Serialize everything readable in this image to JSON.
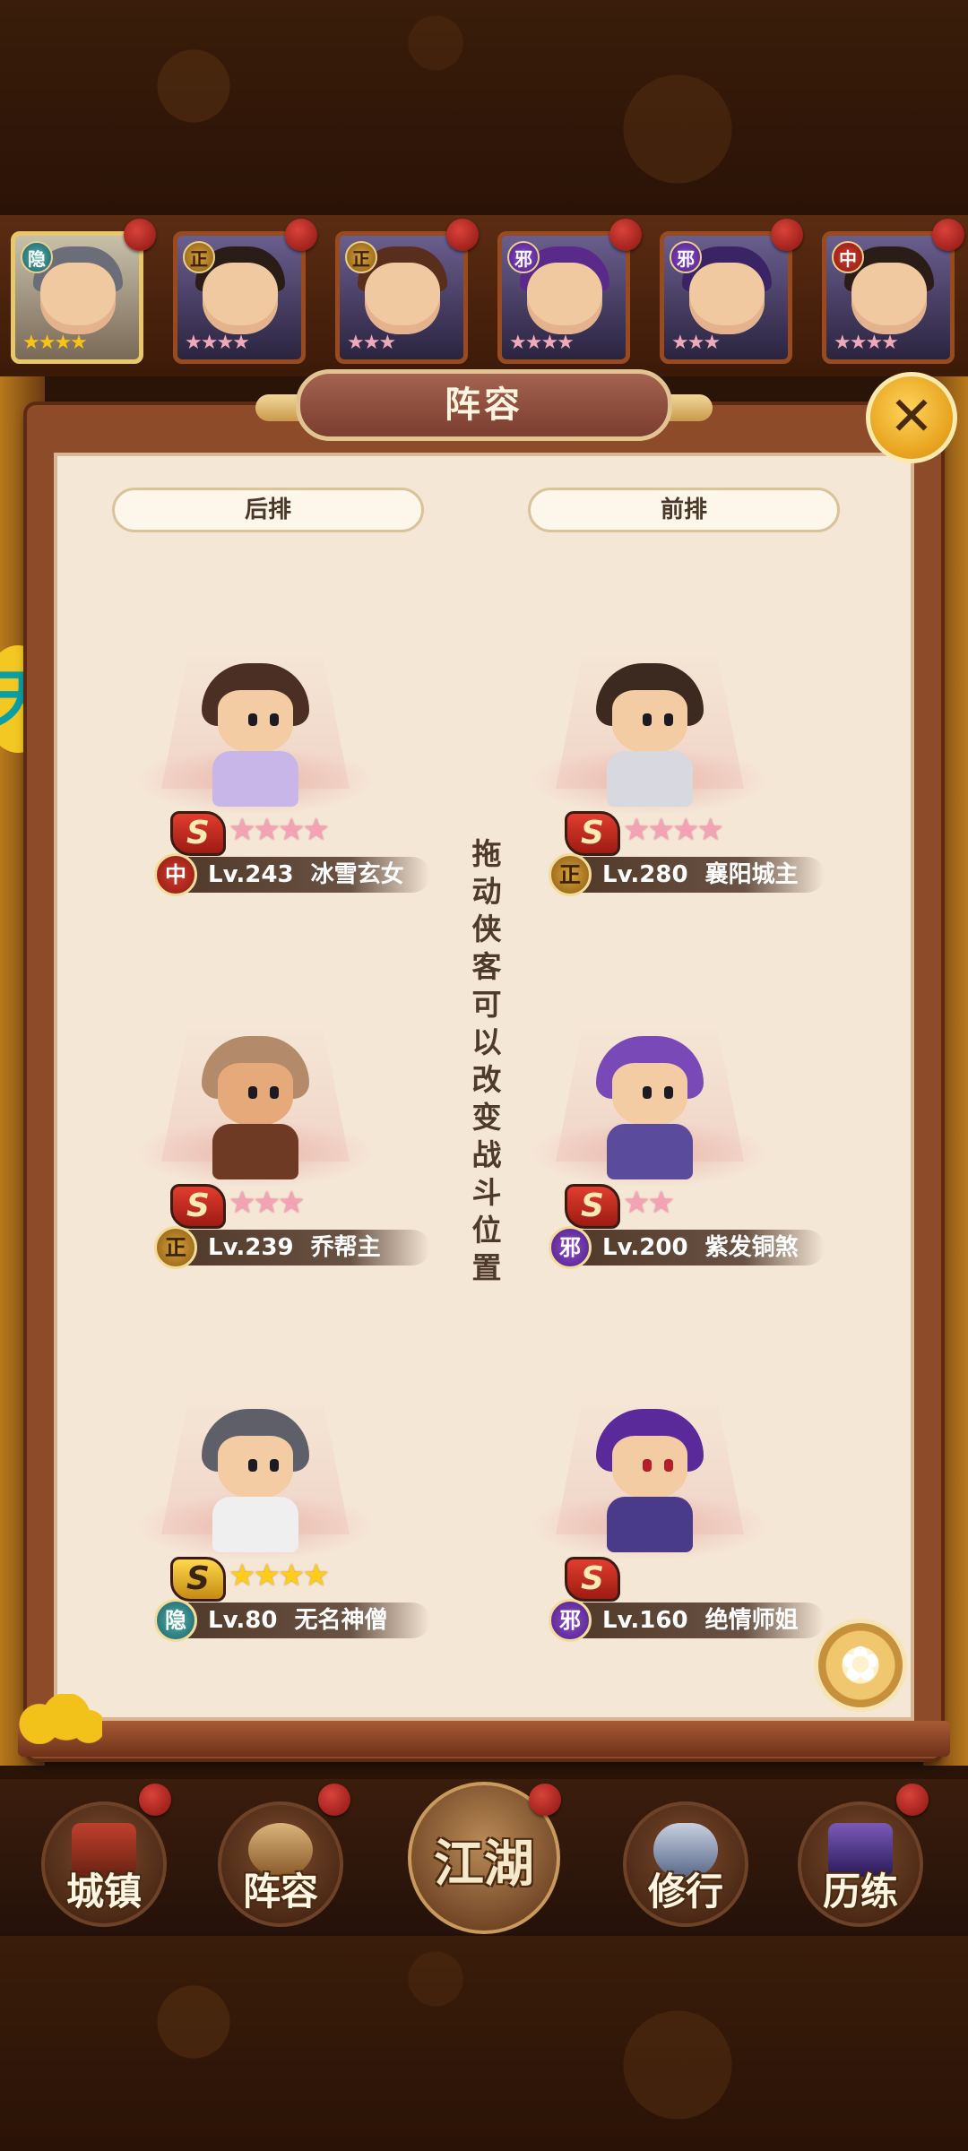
{
  "panel": {
    "title": "阵容",
    "back_row_label": "后排",
    "front_row_label": "前排",
    "hint": "拖动侠客可以改变战斗位置"
  },
  "top_strip": [
    {
      "alignment": "隐",
      "stars": "★★★★",
      "selected": true
    },
    {
      "alignment": "正",
      "stars": "★★★★",
      "selected": false
    },
    {
      "alignment": "正",
      "stars": "★★★",
      "selected": false
    },
    {
      "alignment": "邪",
      "stars": "★★★★",
      "selected": false
    },
    {
      "alignment": "邪",
      "stars": "★★★",
      "selected": false
    },
    {
      "alignment": "中",
      "stars": "★★★★",
      "selected": false
    }
  ],
  "heroes": {
    "back": [
      {
        "alignment": "中",
        "level": "Lv.243",
        "name": "冰雪玄女",
        "rank": "S",
        "stars": "★★★★"
      },
      {
        "alignment": "正",
        "level": "Lv.239",
        "name": "乔帮主",
        "rank": "S",
        "stars": "★★★"
      },
      {
        "alignment": "隐",
        "level": "Lv.80",
        "name": "无名神僧",
        "rank": "S",
        "stars": "★★★★"
      }
    ],
    "front": [
      {
        "alignment": "正",
        "level": "Lv.280",
        "name": "襄阳城主",
        "rank": "S",
        "stars": "★★★★"
      },
      {
        "alignment": "邪",
        "level": "Lv.200",
        "name": "紫发铜煞",
        "rank": "S",
        "stars": "★★"
      },
      {
        "alignment": "邪",
        "level": "Lv.160",
        "name": "绝情师姐",
        "rank": "S",
        "stars": ""
      }
    ]
  },
  "nav": {
    "town": "城镇",
    "lineup": "阵容",
    "jianghu": "江湖",
    "cultivate": "修行",
    "training": "历练"
  },
  "side_emblem": "天",
  "close_icon_glyph": "✕",
  "flower_icon_glyph": "✿",
  "colors": {
    "panel_bg": "#f5e7d6",
    "frame": "#8e4b2a",
    "accent_gold": "#e9c86a",
    "pink_star": "#f4a3b5",
    "gold_star": "#ffcc1a"
  }
}
